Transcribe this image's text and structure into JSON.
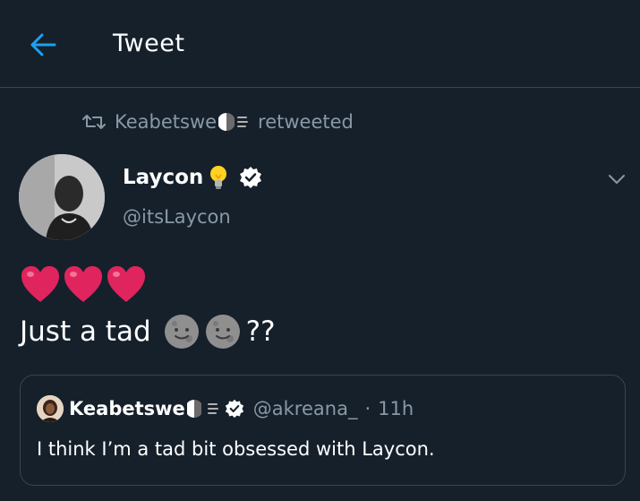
{
  "header": {
    "title": "Tweet",
    "back_icon": "arrow-left-icon"
  },
  "retweet": {
    "user": "Keabetswe",
    "label": "retweeted"
  },
  "tweet": {
    "display_name": "Laycon",
    "handle": "@itsLaycon",
    "hearts": 3,
    "text": "Just a tad",
    "text_suffix": "??"
  },
  "quote": {
    "display_name": "Keabetswe",
    "handle": "@akreana_",
    "separator": "·",
    "time": "11h",
    "text": "I think I’m a tad bit obsessed with Laycon."
  },
  "colors": {
    "background": "#15202b",
    "accent": "#1da1f2",
    "muted": "#8899a6",
    "border": "#38444d",
    "heart": "#e0245e"
  }
}
